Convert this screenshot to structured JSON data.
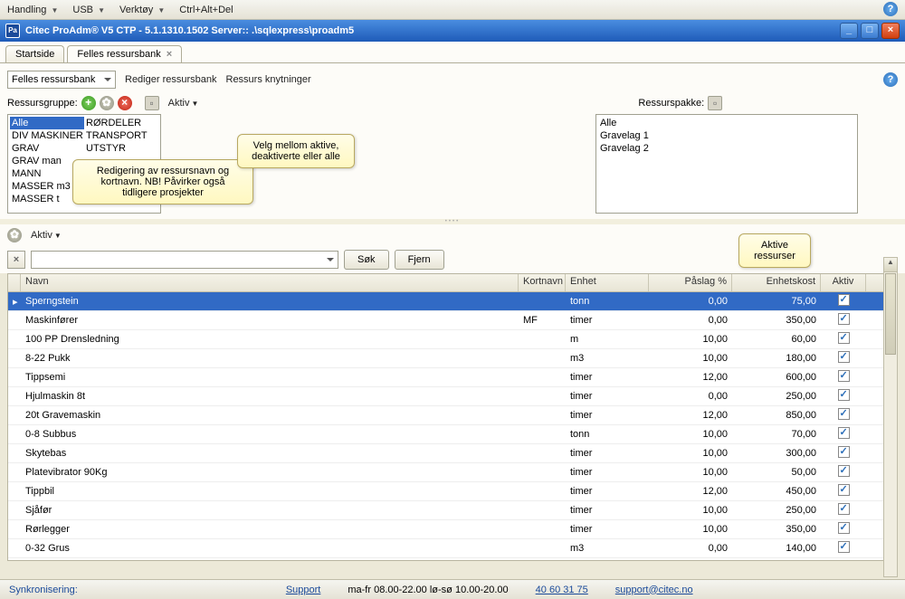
{
  "topmenu": {
    "items": [
      "Handling",
      "USB",
      "Verktøy",
      "Ctrl+Alt+Del"
    ]
  },
  "window_title": "Citec ProAdm® V5 CTP - 5.1.1310.1502 Server:: .\\sqlexpress\\proadm5",
  "tabs": [
    {
      "label": "Startside",
      "active": false
    },
    {
      "label": "Felles ressursbank",
      "active": true
    }
  ],
  "toolbar": {
    "combo_value": "Felles ressursbank",
    "link1": "Rediger ressursbank",
    "link2": "Ressurs knytninger"
  },
  "sub": {
    "label": "Ressursgruppe:",
    "aktiv": "Aktiv"
  },
  "groups_left": [
    "Alle",
    "DIV MASKINER",
    "GRAV",
    "GRAV man",
    "MANN",
    "MASSER m3",
    "MASSER t"
  ],
  "groups_right": [
    "RØRDELER",
    "TRANSPORT",
    "UTSTYR"
  ],
  "pack": {
    "label": "Ressurspakke:",
    "items": [
      "Alle",
      "Gravelag 1",
      "Gravelag 2"
    ]
  },
  "callouts": {
    "c1": "Redigering av ressursnavn og kortnavn. NB! Påvirker også tidligere prosjekter",
    "c2": "Velg mellom aktive, deaktiverte eller alle",
    "c3": "Aktive ressurser"
  },
  "lower": {
    "aktiv": "Aktiv"
  },
  "search": {
    "sok": "Søk",
    "fjern": "Fjern"
  },
  "grid": {
    "headers": {
      "navn": "Navn",
      "kort": "Kortnavn",
      "enh": "Enhet",
      "pas": "Påslag %",
      "kost": "Enhetskost",
      "akt": "Aktiv"
    },
    "rows": [
      {
        "navn": "Sperngstein",
        "kort": "",
        "enh": "tonn",
        "pas": "0,00",
        "kost": "75,00",
        "akt": true,
        "sel": true
      },
      {
        "navn": "Maskinfører",
        "kort": "MF",
        "enh": "timer",
        "pas": "0,00",
        "kost": "350,00",
        "akt": true
      },
      {
        "navn": "100 PP Drensledning",
        "kort": "",
        "enh": "m",
        "pas": "10,00",
        "kost": "60,00",
        "akt": true
      },
      {
        "navn": "8-22 Pukk",
        "kort": "",
        "enh": "m3",
        "pas": "10,00",
        "kost": "180,00",
        "akt": true
      },
      {
        "navn": "Tippsemi",
        "kort": "",
        "enh": "timer",
        "pas": "12,00",
        "kost": "600,00",
        "akt": true
      },
      {
        "navn": "Hjulmaskin 8t",
        "kort": "",
        "enh": "timer",
        "pas": "0,00",
        "kost": "250,00",
        "akt": true
      },
      {
        "navn": "20t Gravemaskin",
        "kort": "",
        "enh": "timer",
        "pas": "12,00",
        "kost": "850,00",
        "akt": true
      },
      {
        "navn": "0-8  Subbus",
        "kort": "",
        "enh": "tonn",
        "pas": "10,00",
        "kost": "70,00",
        "akt": true
      },
      {
        "navn": "Skytebas",
        "kort": "",
        "enh": "timer",
        "pas": "10,00",
        "kost": "300,00",
        "akt": true
      },
      {
        "navn": "Platevibrator 90Kg",
        "kort": "",
        "enh": "timer",
        "pas": "10,00",
        "kost": "50,00",
        "akt": true
      },
      {
        "navn": "Tippbil",
        "kort": "",
        "enh": "timer",
        "pas": "12,00",
        "kost": "450,00",
        "akt": true
      },
      {
        "navn": "Sjåfør",
        "kort": "",
        "enh": "timer",
        "pas": "10,00",
        "kost": "250,00",
        "akt": true
      },
      {
        "navn": "Rørlegger",
        "kort": "",
        "enh": "timer",
        "pas": "10,00",
        "kost": "350,00",
        "akt": true
      },
      {
        "navn": "0-32 Grus",
        "kort": "",
        "enh": "m3",
        "pas": "0,00",
        "kost": "140,00",
        "akt": true
      }
    ]
  },
  "status": {
    "sync": "Synkronisering:",
    "support": "Support",
    "hours": "ma-fr 08.00-22.00 lø-sø 10.00-20.00",
    "phone": "40 60 31 75",
    "email": "support@citec.no"
  }
}
